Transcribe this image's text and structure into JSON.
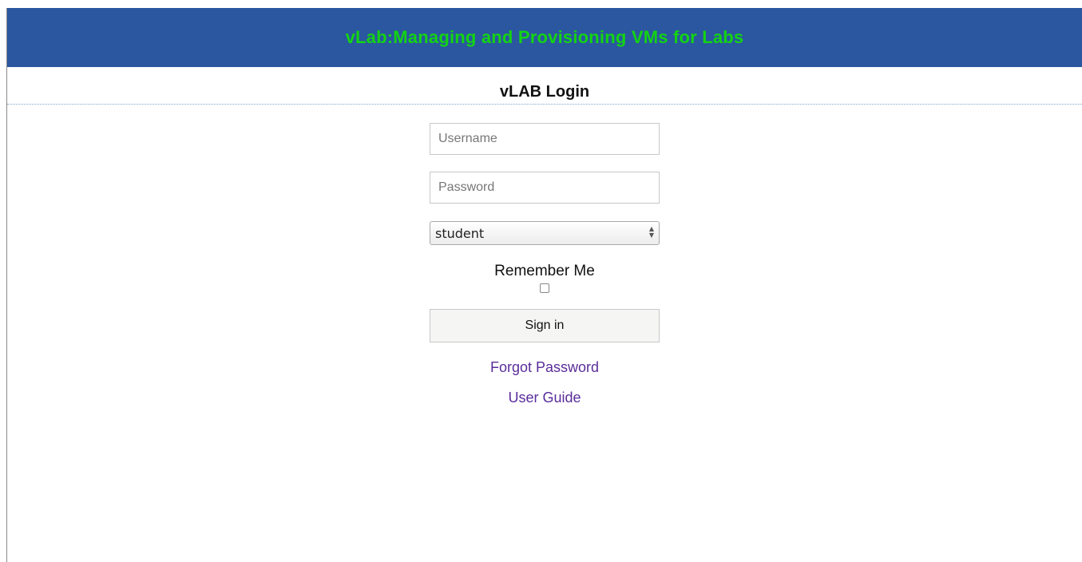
{
  "header": {
    "title": "vLab:Managing and Provisioning VMs for Labs",
    "background": "#2b56a0",
    "title_color": "#13d313"
  },
  "login": {
    "heading": "vLAB Login",
    "username": {
      "placeholder": "Username",
      "value": ""
    },
    "password": {
      "placeholder": "Password",
      "value": ""
    },
    "role_select": {
      "selected": "student"
    },
    "remember_label": "Remember Me",
    "remember_checked": false,
    "signin_label": "Sign in",
    "forgot_password_label": "Forgot Password",
    "user_guide_label": "User Guide",
    "link_color": "#5a2d9a"
  }
}
